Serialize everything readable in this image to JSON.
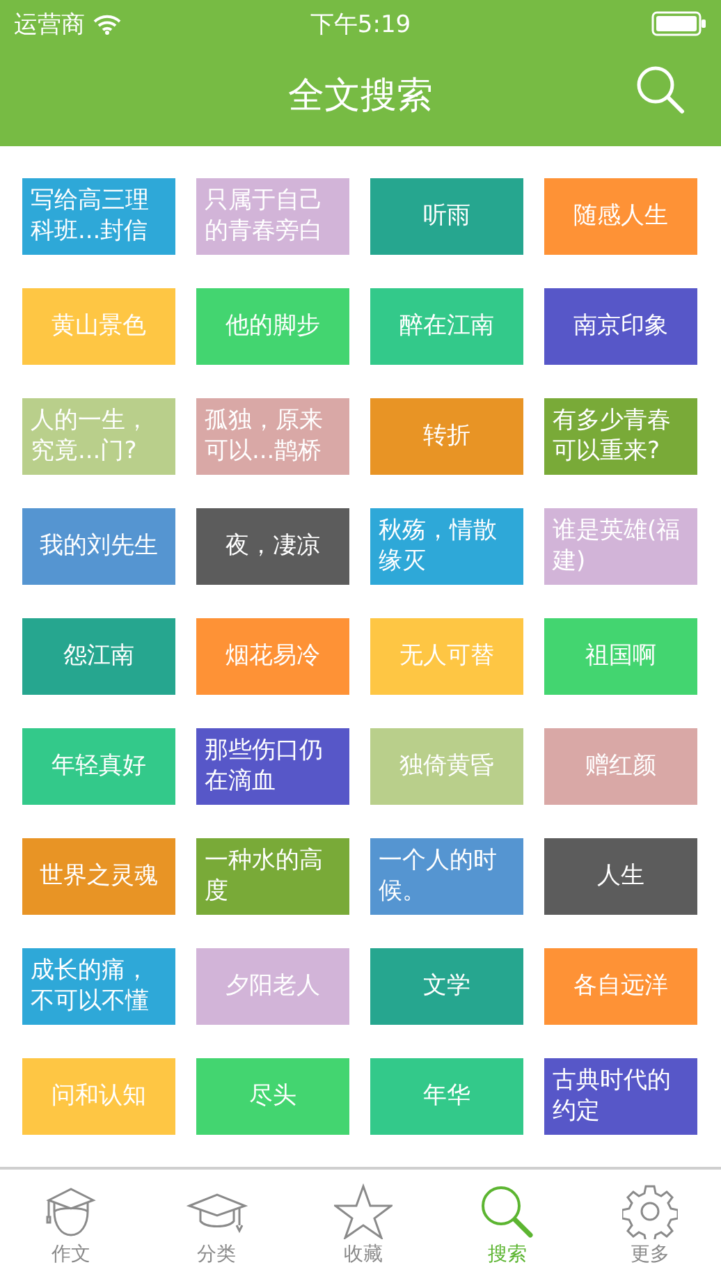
{
  "status_bar": {
    "carrier": "运营商",
    "time": "下午5:19"
  },
  "nav_bar": {
    "title": "全文搜索"
  },
  "tiles": [
    {
      "label": "写给高三理科班...封信",
      "color": "#2ea8d8"
    },
    {
      "label": "只属于自己的青春旁白",
      "color": "#d2b4d8"
    },
    {
      "label": "听雨",
      "color": "#26a68f"
    },
    {
      "label": "随感人生",
      "color": "#fe9236"
    },
    {
      "label": "黄山景色",
      "color": "#fec644"
    },
    {
      "label": "他的脚步",
      "color": "#43d570"
    },
    {
      "label": "醉在江南",
      "color": "#33c98a"
    },
    {
      "label": "南京印象",
      "color": "#5757c8"
    },
    {
      "label": "人的一生，究竟...门?",
      "color": "#b9cf8b"
    },
    {
      "label": "孤独，原来可以...鹊桥",
      "color": "#d9a8a6"
    },
    {
      "label": "转折",
      "color": "#e89425"
    },
    {
      "label": "有多少青春可以重来?",
      "color": "#79aa38"
    },
    {
      "label": "我的刘先生",
      "color": "#5595d1"
    },
    {
      "label": "夜，凄凉",
      "color": "#5c5c5c"
    },
    {
      "label": "秋殇，情散缘灭",
      "color": "#2ea8d8"
    },
    {
      "label": "谁是英雄(福建)",
      "color": "#d2b4d8"
    },
    {
      "label": "怨江南",
      "color": "#26a68f"
    },
    {
      "label": "烟花易冷",
      "color": "#fe9236"
    },
    {
      "label": "无人可替",
      "color": "#fec644"
    },
    {
      "label": "祖国啊",
      "color": "#43d570"
    },
    {
      "label": "年轻真好",
      "color": "#33c98a"
    },
    {
      "label": "那些伤口仍在滴血",
      "color": "#5757c8"
    },
    {
      "label": "独倚黄昏",
      "color": "#b9cf8b"
    },
    {
      "label": "赠红颜",
      "color": "#d9a8a6"
    },
    {
      "label": "世界之灵魂",
      "color": "#e89425"
    },
    {
      "label": "一种水的高度",
      "color": "#79aa38"
    },
    {
      "label": "一个人的时候。",
      "color": "#5595d1"
    },
    {
      "label": "人生",
      "color": "#5c5c5c"
    },
    {
      "label": "成长的痛，不可以不懂",
      "color": "#2ea8d8"
    },
    {
      "label": "夕阳老人",
      "color": "#d2b4d8"
    },
    {
      "label": "文学",
      "color": "#26a68f"
    },
    {
      "label": "各自远洋",
      "color": "#fe9236"
    },
    {
      "label": "问和认知",
      "color": "#fec644"
    },
    {
      "label": "尽头",
      "color": "#43d570"
    },
    {
      "label": "年华",
      "color": "#33c98a"
    },
    {
      "label": "古典时代的约定",
      "color": "#5757c8"
    }
  ],
  "tab_bar": [
    {
      "label": "作文",
      "kind": "student",
      "selected": false
    },
    {
      "label": "分类",
      "kind": "cap",
      "selected": false
    },
    {
      "label": "收藏",
      "kind": "star",
      "selected": false
    },
    {
      "label": "搜索",
      "kind": "search",
      "selected": true
    },
    {
      "label": "更多",
      "kind": "gear",
      "selected": false
    }
  ]
}
